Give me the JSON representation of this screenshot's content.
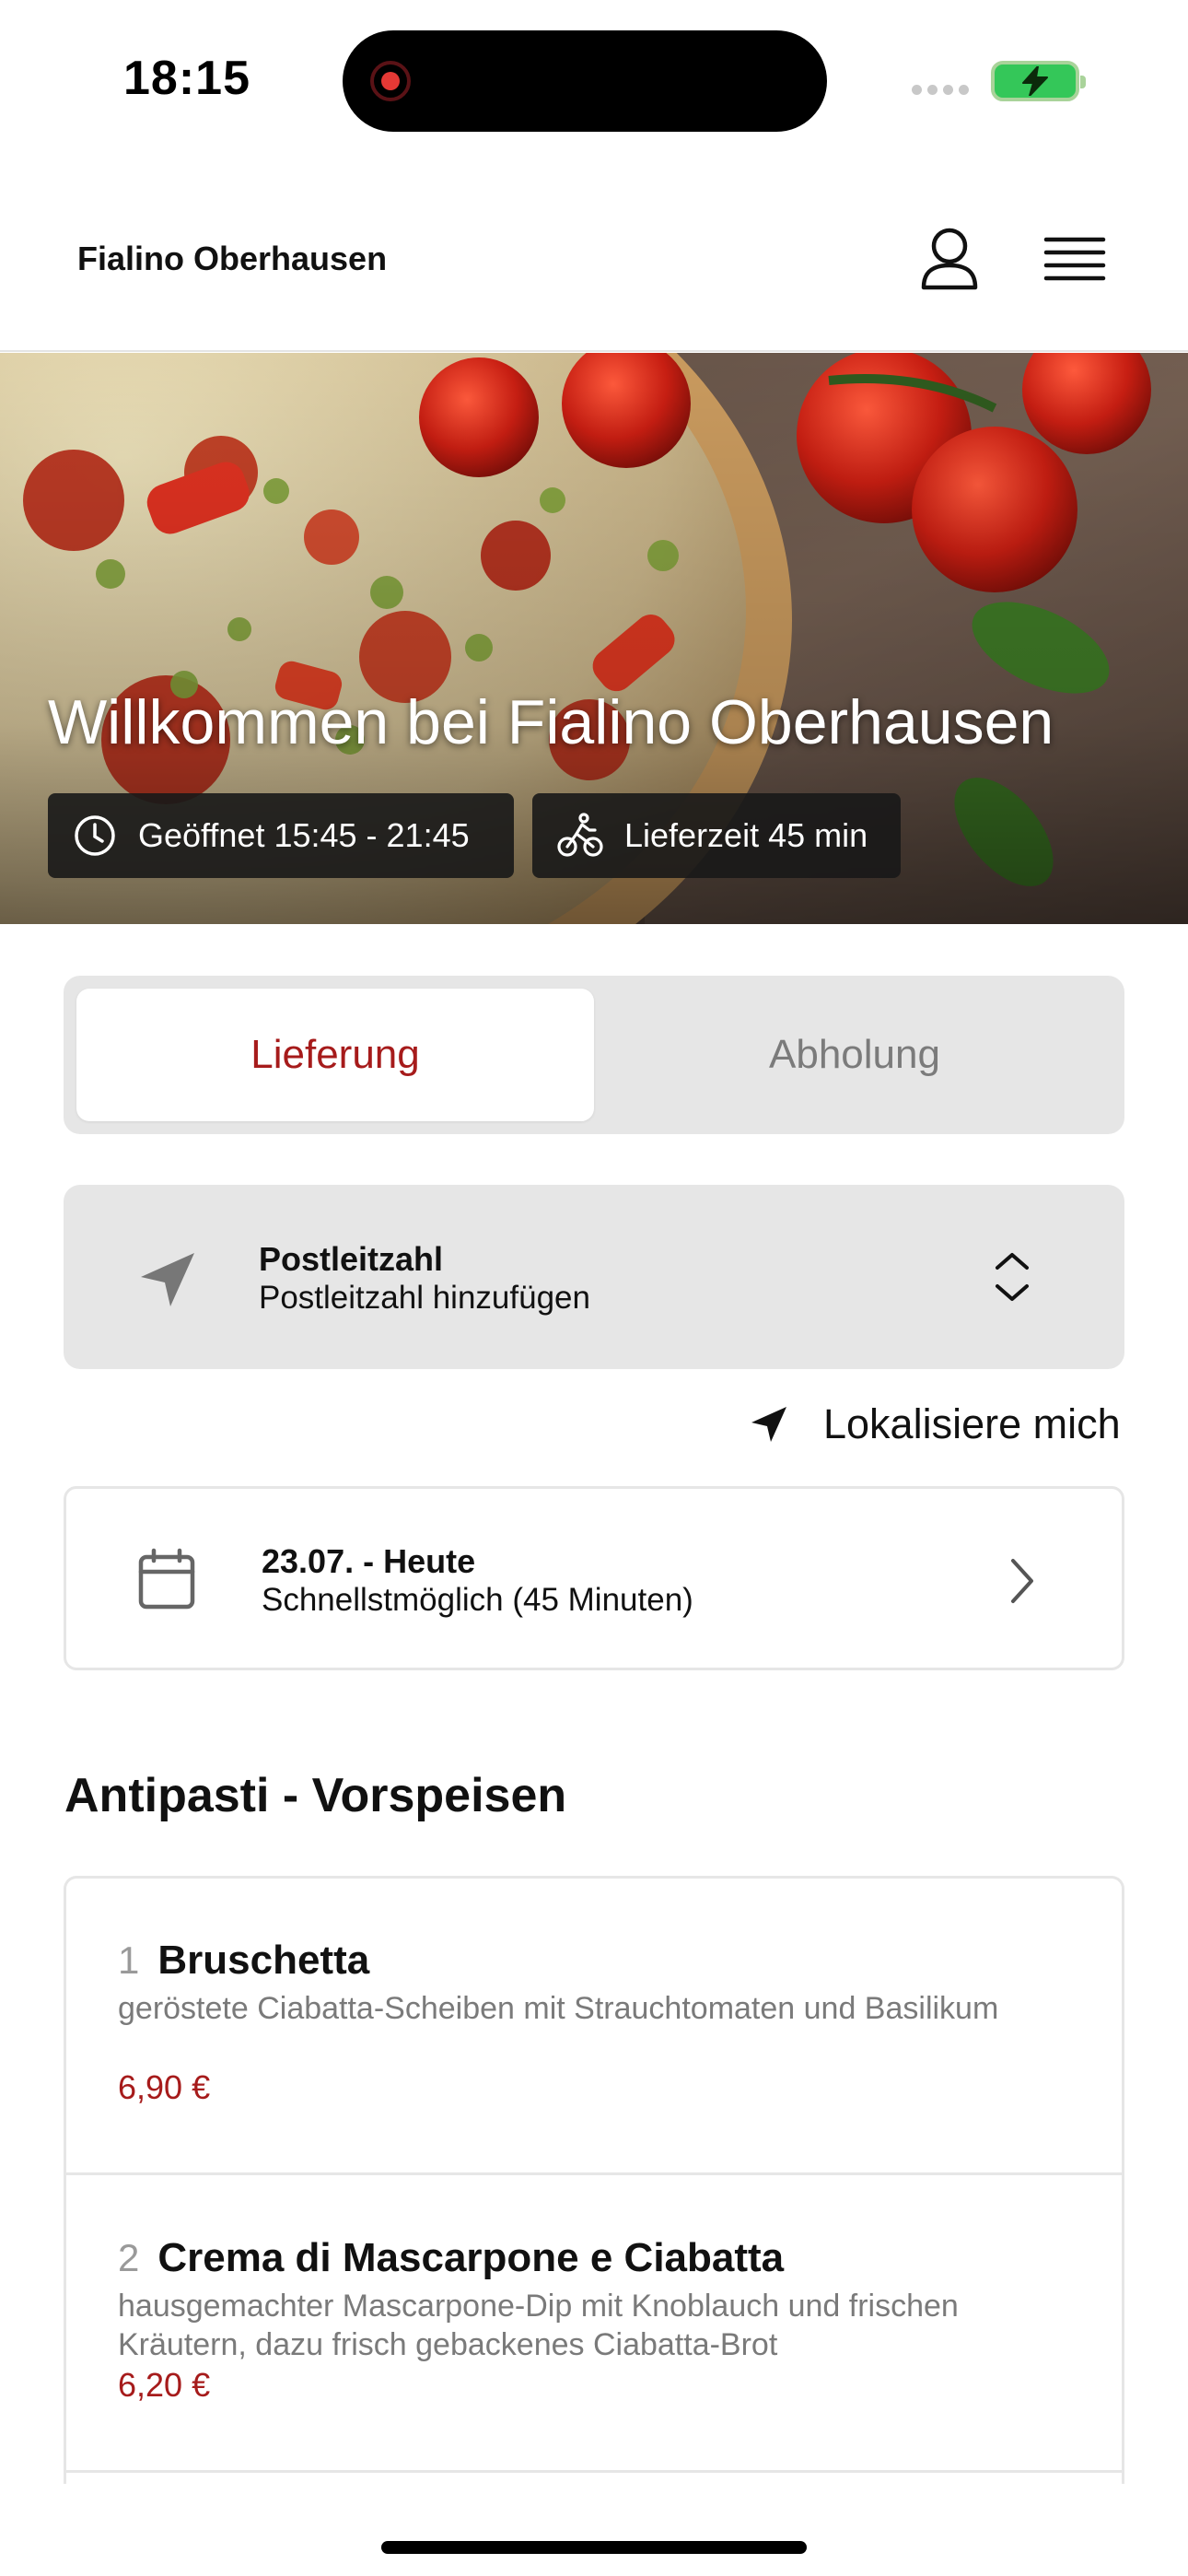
{
  "status_bar": {
    "time": "18:15"
  },
  "header": {
    "restaurant_name": "Fialino Oberhausen"
  },
  "hero": {
    "title": "Willkommen bei Fialino Oberhausen",
    "opening_hours": "Geöffnet 15:45 - 21:45",
    "delivery_time": "Lieferzeit 45 min"
  },
  "mode_toggle": {
    "delivery_label": "Lieferung",
    "pickup_label": "Abholung",
    "selected": "Lieferung"
  },
  "postal": {
    "label": "Postleitzahl",
    "placeholder": "Postleitzahl hinzufügen"
  },
  "locate": {
    "label": "Lokalisiere mich"
  },
  "date": {
    "label": "23.07. - Heute",
    "value": "Schnellstmöglich (45 Minuten)"
  },
  "section": {
    "title": "Antipasti - Vorspeisen"
  },
  "products": [
    {
      "number": "1",
      "name": "Bruschetta",
      "description": "geröstete Ciabatta-Scheiben mit Strauchtomaten und Basilikum",
      "price": "6,90 €"
    },
    {
      "number": "2",
      "name": "Crema di Mascarpone e Ciabatta",
      "description": "hausgemachter Mascarpone-Dip mit Knoblauch und frischen Kräutern, dazu frisch gebackenes Ciabatta-Brot",
      "price": "6,20 €"
    }
  ],
  "colors": {
    "accent": "#a61b1b",
    "surface": "#e6e6e6",
    "battery": "#34c759"
  },
  "icons": [
    "profile-icon",
    "hamburger-menu-icon",
    "clock-icon",
    "bicycle-icon",
    "location-arrow-icon",
    "chevron-up-down-icon",
    "calendar-icon",
    "chevron-right-icon"
  ]
}
